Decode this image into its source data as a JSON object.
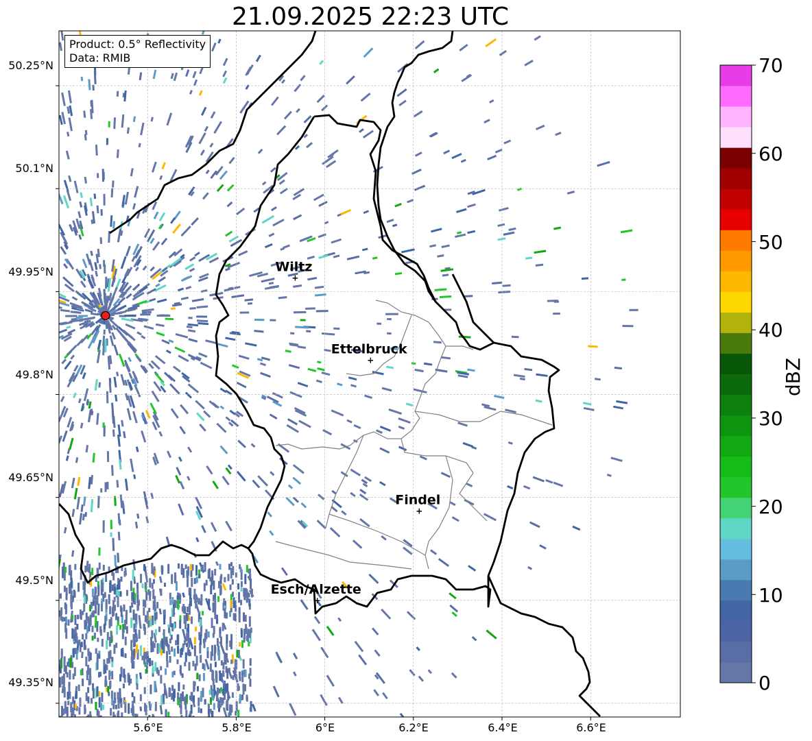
{
  "title": "21.09.2025 22:23 UTC",
  "info": {
    "product": "Product: 0.5° Reflectivity",
    "source": "Data: RMIB"
  },
  "axes": {
    "lat_ticks": [
      "50.25°N",
      "50.1°N",
      "49.95°N",
      "49.8°N",
      "49.65°N",
      "49.5°N",
      "49.35°N"
    ],
    "lon_ticks": [
      "5.6°E",
      "5.8°E",
      "6°E",
      "6.2°E",
      "6.4°E",
      "6.6°E"
    ]
  },
  "cities": [
    {
      "name": "Wiltz",
      "lon": 5.93,
      "lat": 49.97
    },
    {
      "name": "Ettelbruck",
      "lon": 6.1,
      "lat": 49.85
    },
    {
      "name": "Findel",
      "lon": 6.21,
      "lat": 49.63
    },
    {
      "name": "Esch/Alzette",
      "lon": 5.98,
      "lat": 49.5
    }
  ],
  "radar_site": {
    "lon": 5.505,
    "lat": 49.915,
    "color": "#ee1c1c"
  },
  "colorbar": {
    "label": "dBZ",
    "min": 0,
    "max": 70,
    "step": 2.5,
    "tick_labels": [
      "0",
      "10",
      "20",
      "30",
      "40",
      "50",
      "60",
      "70"
    ],
    "colors": [
      "#6577a8",
      "#5a6ea6",
      "#4c64a4",
      "#4265a5",
      "#4a7bb0",
      "#5a9cc6",
      "#65bede",
      "#5fd6c6",
      "#43d274",
      "#22c62a",
      "#16bc16",
      "#12a812",
      "#0f940f",
      "#0d800d",
      "#0b6a0b",
      "#085608",
      "#4b7a0c",
      "#b2b20c",
      "#ffd800",
      "#ffb800",
      "#ff9a00",
      "#ff7a00",
      "#e80000",
      "#c20000",
      "#a00000",
      "#7a0000",
      "#ffe0ff",
      "#ffb4ff",
      "#ff6cff",
      "#e83ce8"
    ]
  }
}
